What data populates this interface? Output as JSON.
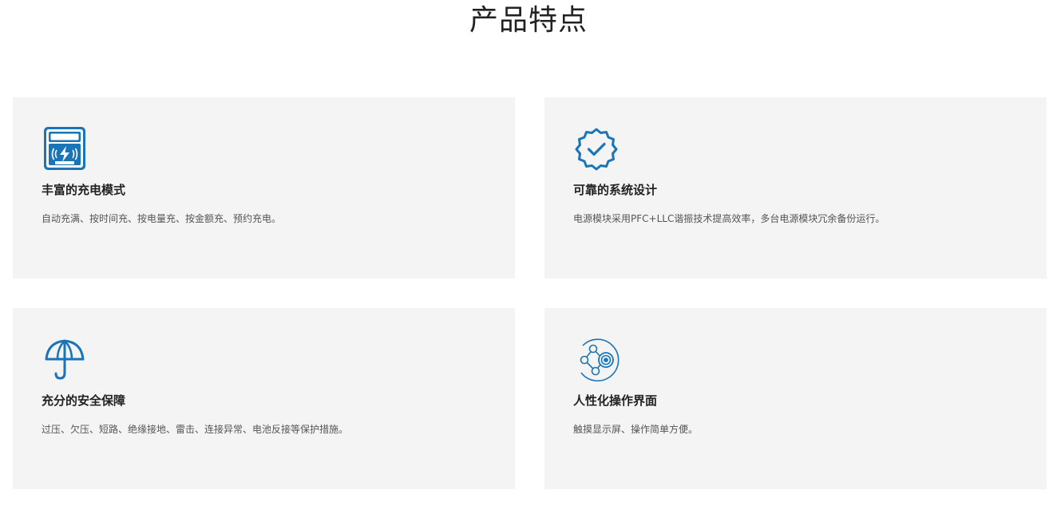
{
  "page": {
    "title": "产品特点"
  },
  "colors": {
    "accent": "#1a75b8",
    "card_bg": "#f4f4f4",
    "title_text": "#222222",
    "desc_text": "#555555"
  },
  "features": [
    {
      "icon": "charging-meter-icon",
      "title": "丰富的充电模式",
      "desc": "自动充满、按时间充、按电量充、按金额充、预约充电。"
    },
    {
      "icon": "badge-check-icon",
      "title": "可靠的系统设计",
      "desc": "电源模块采用PFC+LLC谐振技术提高效率，多台电源模块冗余备份运行。"
    },
    {
      "icon": "umbrella-icon",
      "title": "充分的安全保障",
      "desc": "过压、欠压、短路、绝缘接地、雷击、连接异常、电池反接等保护措施。"
    },
    {
      "icon": "network-nodes-icon",
      "title": "人性化操作界面",
      "desc": "触摸显示屏、操作简单方便。"
    }
  ]
}
